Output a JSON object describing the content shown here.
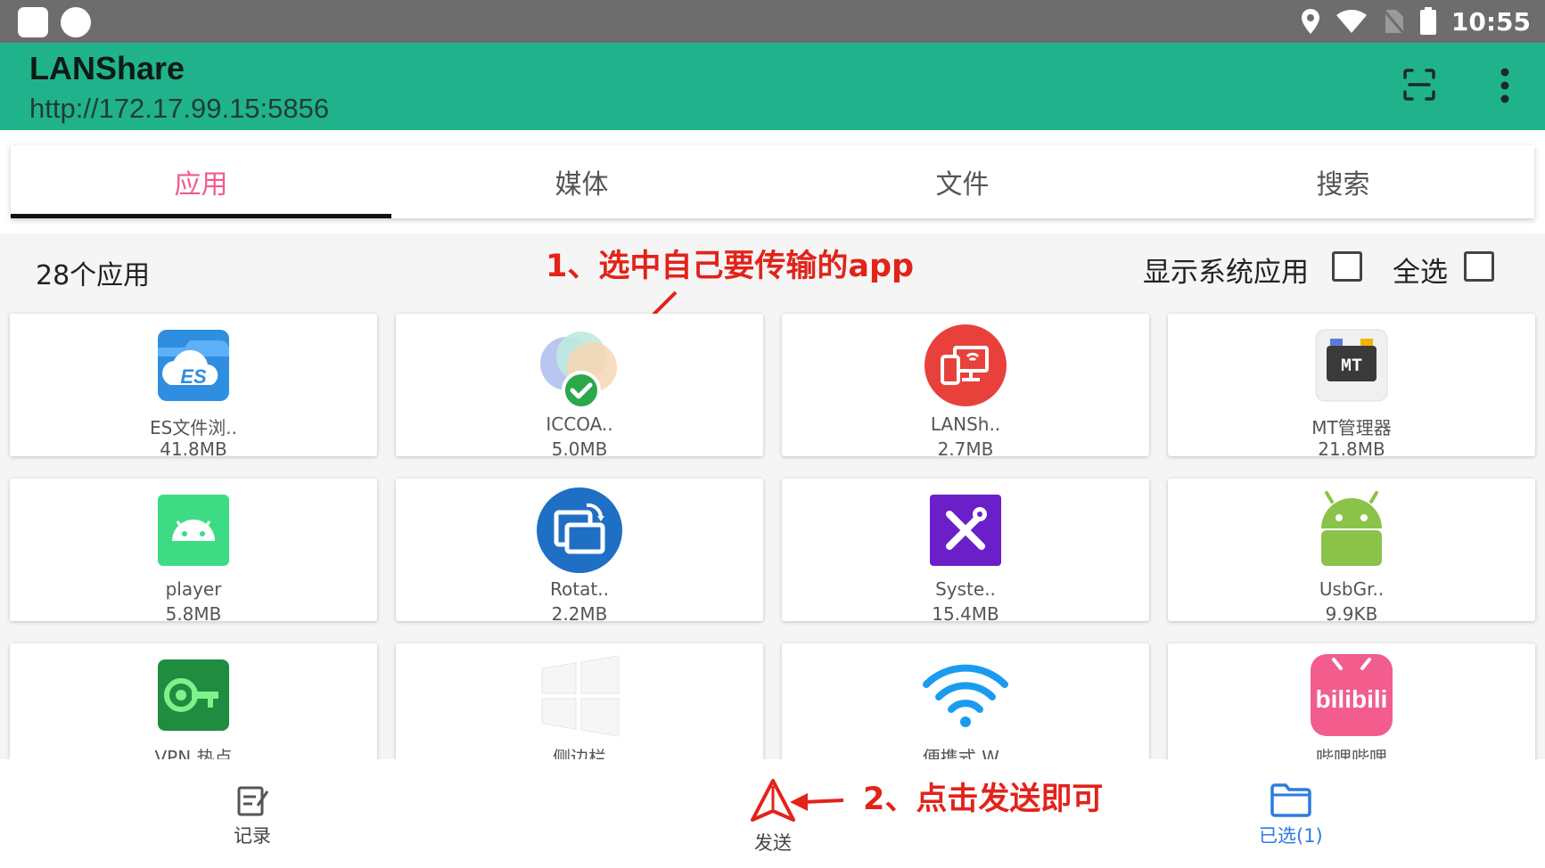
{
  "status_bar": {
    "time": "10:55"
  },
  "app_bar": {
    "title": "LANShare",
    "url": "http://172.17.99.15:5856"
  },
  "tabs": [
    {
      "label": "应用",
      "active": true
    },
    {
      "label": "媒体",
      "active": false
    },
    {
      "label": "文件",
      "active": false
    },
    {
      "label": "搜索",
      "active": false
    }
  ],
  "content": {
    "count_label": "28个应用",
    "show_system_label": "显示系统应用",
    "select_all_label": "全选",
    "annotation_1": "1、选中自己要传输的app"
  },
  "apps": [
    {
      "name": "ES文件浏..",
      "size": "41.8MB",
      "icon": "es-file-explorer-icon",
      "selected": false
    },
    {
      "name": "ICCOA..",
      "size": "5.0MB",
      "icon": "iccoa-icon",
      "selected": true
    },
    {
      "name": "LANSh..",
      "size": "2.7MB",
      "icon": "lanshare-icon",
      "selected": false
    },
    {
      "name": "MT管理器",
      "size": "21.8MB",
      "icon": "mt-manager-icon",
      "selected": false
    },
    {
      "name": "player",
      "size": "5.8MB",
      "icon": "android-player-icon",
      "selected": false
    },
    {
      "name": "Rotat..",
      "size": "2.2MB",
      "icon": "rotation-icon",
      "selected": false
    },
    {
      "name": "Syste..",
      "size": "15.4MB",
      "icon": "system-tools-icon",
      "selected": false
    },
    {
      "name": "UsbGr..",
      "size": "9.9KB",
      "icon": "android-robot-icon",
      "selected": false
    },
    {
      "name": "VPN 热点",
      "size": "",
      "icon": "vpn-key-icon",
      "selected": false
    },
    {
      "name": "侧边栏",
      "size": "",
      "icon": "sidebar-windows-icon",
      "selected": false
    },
    {
      "name": "便携式 W..",
      "size": "",
      "icon": "wifi-icon",
      "selected": false
    },
    {
      "name": "哔哩哔哩",
      "size": "",
      "icon": "bilibili-icon",
      "selected": false
    }
  ],
  "bottom_nav": {
    "records_label": "记录",
    "send_label": "发送",
    "selected_label": "已选(1)",
    "annotation_2": "2、点击发送即可"
  },
  "colors": {
    "status_bar": "#6d6d6d",
    "app_bar": "#20b38b",
    "tab_active": "#f25a8c",
    "annotation": "#e2231a",
    "selected_nav": "#2d7be0"
  }
}
